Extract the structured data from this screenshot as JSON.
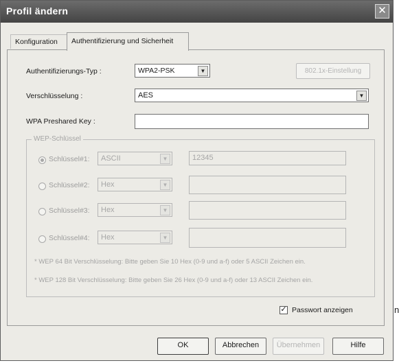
{
  "window": {
    "title": "Profil ändern",
    "close_label": "✕"
  },
  "tabs": [
    {
      "label": "Konfiguration",
      "active": false
    },
    {
      "label": "Authentifizierung und Sicherheit",
      "active": true
    }
  ],
  "form": {
    "auth_type": {
      "label": "Authentifizierungs-Typ :",
      "value": "WPA2-PSK"
    },
    "dot1x_button": {
      "label": "802.1x-Einstellung"
    },
    "encryption": {
      "label": "Verschlüsselung :",
      "value": "AES"
    },
    "wpa_key": {
      "label": "WPA Preshared Key :",
      "value": ""
    }
  },
  "wep": {
    "legend": "WEP-Schlüssel",
    "rows": [
      {
        "label": "Schlüssel#1:",
        "format": "ASCII",
        "key": "12345",
        "checked": true
      },
      {
        "label": "Schlüssel#2:",
        "format": "Hex",
        "key": "",
        "checked": false
      },
      {
        "label": "Schlüssel#3:",
        "format": "Hex",
        "key": "",
        "checked": false
      },
      {
        "label": "Schlüssel#4:",
        "format": "Hex",
        "key": "",
        "checked": false
      }
    ],
    "note1": "* WEP 64 Bit Verschlüsselung: Bitte geben Sie 10 Hex (0-9 und a-f) oder 5 ASCII Zeichen ein.",
    "note2": "* WEP 128 Bit Verschlüsselung: Bitte geben Sie 26 Hex (0-9 und a-f) oder 13 ASCII Zeichen ein."
  },
  "show_password": {
    "label": "Passwort anzeigen",
    "checked": true
  },
  "buttons": {
    "ok": "OK",
    "cancel": "Abbrechen",
    "apply": "Übernehmen",
    "help": "Hilfe"
  },
  "stray_text": "n"
}
